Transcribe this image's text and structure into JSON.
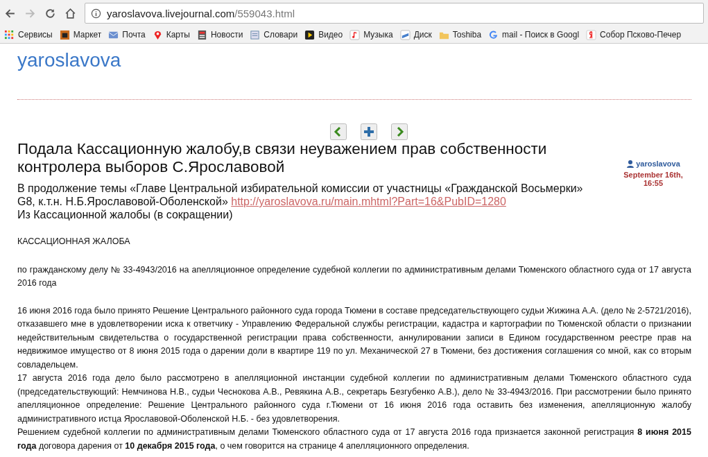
{
  "browser": {
    "url_host": "yaroslavova.livejournal.com",
    "url_path": "/559043.html",
    "bookmarks": [
      {
        "label": "Сервисы",
        "kind": "apps"
      },
      {
        "label": "Маркет",
        "kind": "market"
      },
      {
        "label": "Почта",
        "kind": "mail"
      },
      {
        "label": "Карты",
        "kind": "pin"
      },
      {
        "label": "Новости",
        "kind": "news"
      },
      {
        "label": "Словари",
        "kind": "dict"
      },
      {
        "label": "Видео",
        "kind": "video"
      },
      {
        "label": "Музыка",
        "kind": "music"
      },
      {
        "label": "Диск",
        "kind": "disk"
      },
      {
        "label": "Toshiba",
        "kind": "folder"
      },
      {
        "label": "mail - Поиск в Googl",
        "kind": "google"
      },
      {
        "label": "Собор Псково-Печер",
        "kind": "yandex"
      }
    ]
  },
  "blog": {
    "title": "yaroslavova"
  },
  "post": {
    "title": "Подала Кассационную жалобу,в связи неуважением прав собственности контролера выборов С.Ярославовой",
    "author": "yaroslavova",
    "date": "September 16th, 16:55",
    "intro": "В  продолжение темы  «Главе Центральной избирательной комиссии от участницы «Гражданской Восьмерки» G8, к.т.н. Н.Б.Ярославовой-Оболенской»",
    "intro_link": "http://yaroslavova.ru/main.mhtml?Part=16&PubID=1280",
    "subtitle": "Из  Кассационной   жалобы (в сокращении)",
    "body": [
      "КАССАЦИОННАЯ  ЖАЛОБА",
      "по гражданскому делу  № 33-4943/2016   на   апелляционное   определение  судебной  коллегии по  административным  делами  Тюменского  областного  суда   от 17 августа   2016 года",
      "16 июня 2016 года  было   принято   Решение Центрального  районного  суда   города Тюмени в  составе председательствующего судьи Жижина А.А. (дело № 2-5721/2016), отказавшего мне  в удовлетворении  иска  к  ответчику -  Управлению  Федеральной  службы регистрации, кадастра  и картографии  по  Тюменской области  о признании недействительным свидетельства  о  государственной   регистрации права собственности, аннулировании записи в  Едином государственном  реестре  прав на недвижимое имущество  от 8 июня  2015 года  о дарении  доли  в квартире 119 по ул. Механической  27  в Тюмени,  без достижения  соглашения  со мной, как  со вторым  совладельцем.",
      "17 августа   2016  года дело было   рассмотрено  в  апелляционной  инстанции судебной  коллегии по  административным  делами  Тюменского  областного суда  (председательствующий: Немчинова Н.В., судьи  Чеснокова  А.В.,  Ревякина  А.В., секретарь  Безгубенко А.В.),  дело  № 33-4943/2016. При рассмотрении было принято апелляционное определение: Решение  Центрального  районного суда  г.Тюмени от 16  июня   2016 года   оставить  без изменения,  апелляционную   жалобу   административного    истца  Ярославовой-Оболенской  Н.Б. -  без удовлетворения.",
      "Решением  судебной  коллегии по  административным  делами  Тюменского  областного суда  от 17 августа  2016 года  признается  законной регистрация  **8  июня  2015 года**  договора  дарения  от **10  декабря  2015 года**, о чем говорится  на странице  4  апелляционного  определения."
    ]
  }
}
